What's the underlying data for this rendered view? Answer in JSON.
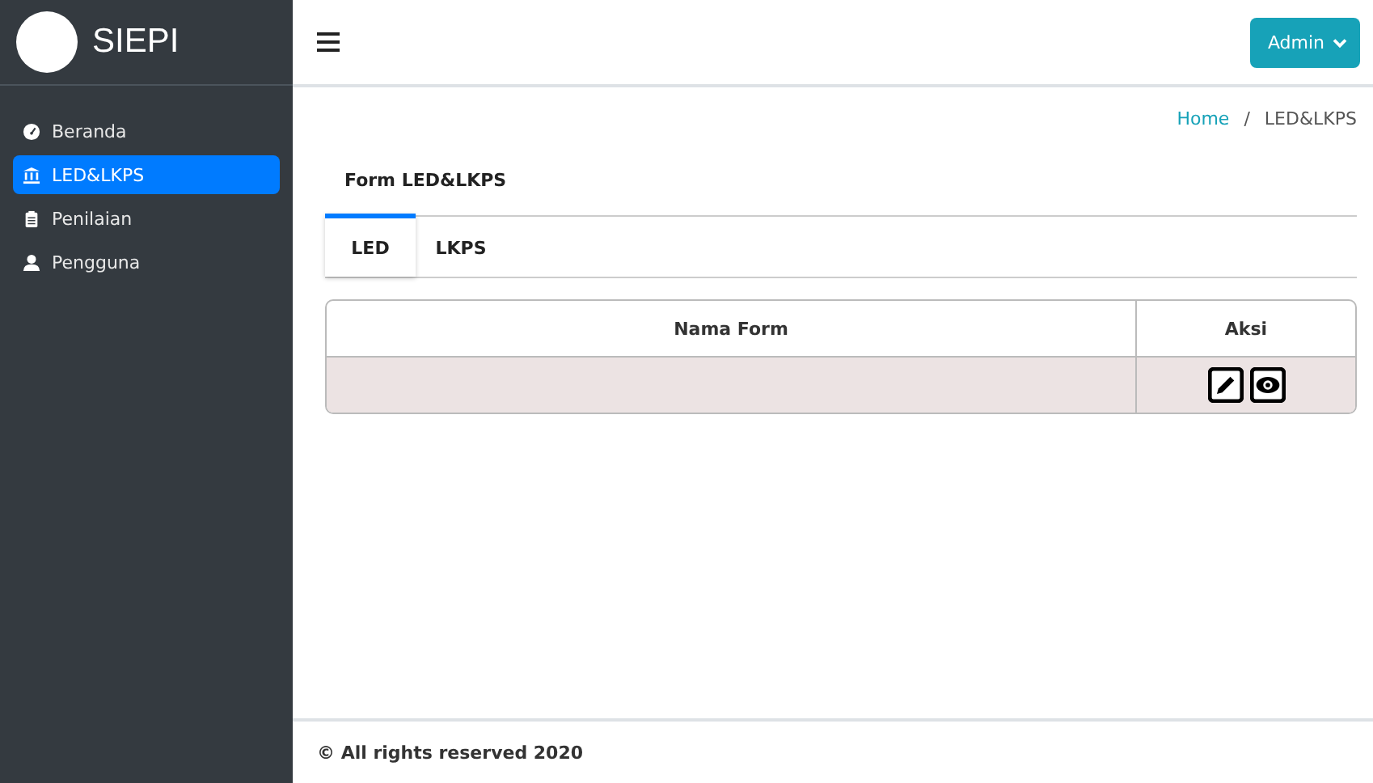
{
  "brand": {
    "name": "SIEPI"
  },
  "sidebar": {
    "items": [
      {
        "label": "Beranda",
        "kind": "gauge",
        "selected": false
      },
      {
        "label": "LED&LKPS",
        "kind": "bank",
        "selected": true
      },
      {
        "label": "Penilaian",
        "kind": "clipboard",
        "selected": false
      },
      {
        "label": "Pengguna",
        "kind": "user",
        "selected": false
      }
    ]
  },
  "header": {
    "user_button": "Admin"
  },
  "breadcrumb": {
    "link": "Home",
    "separator": "/",
    "current": "LED&LKPS"
  },
  "card": {
    "title": "Form LED&LKPS",
    "tabs": [
      {
        "label": "LED",
        "selected": true
      },
      {
        "label": "LKPS",
        "selected": false
      }
    ],
    "table": {
      "columns": [
        "Nama Form",
        "Aksi"
      ],
      "rows": [
        {
          "actions": [
            {
              "kind": "edit"
            },
            {
              "kind": "view"
            }
          ]
        }
      ]
    }
  },
  "footer": "© All rights reserved 2020"
}
